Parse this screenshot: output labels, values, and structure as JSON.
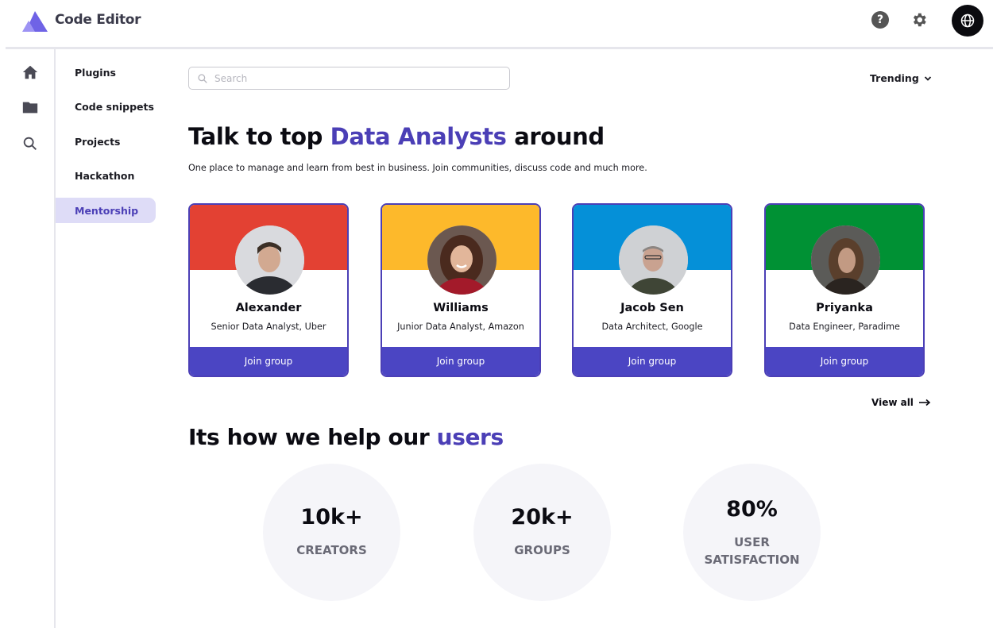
{
  "app": {
    "title": "Code Editor"
  },
  "header": {
    "help_glyph": "?"
  },
  "rail": {
    "icons": [
      "home-icon",
      "folder-icon",
      "search-icon"
    ]
  },
  "sidebar": {
    "items": [
      {
        "label": "Plugins"
      },
      {
        "label": "Code snippets"
      },
      {
        "label": "Projects"
      },
      {
        "label": "Hackathon"
      },
      {
        "label": "Mentorship",
        "active": true
      }
    ]
  },
  "search": {
    "placeholder": "Search",
    "value": ""
  },
  "sort": {
    "label": "Trending"
  },
  "hero": {
    "title_pre": "Talk to top ",
    "title_accent": "Data Analysts",
    "title_post": " around",
    "subtitle": "One place to manage and learn from best in business. Join communities, discuss code and much more."
  },
  "mentors": [
    {
      "name": "Alexander",
      "role": "Senior Data Analyst, Uber",
      "color": "#e34133",
      "button": "Join group"
    },
    {
      "name": "Williams",
      "role": "Junior Data Analyst, Amazon",
      "color": "#fdb92b",
      "button": "Join group"
    },
    {
      "name": "Jacob Sen",
      "role": "Data Architect, Google",
      "color": "#0590d8",
      "button": "Join group"
    },
    {
      "name": "Priyanka",
      "role": "Data Engineer, Paradime",
      "color": "#009134",
      "button": "Join group"
    }
  ],
  "view_all": "View all",
  "stats": {
    "title_pre": "Its how we help our ",
    "title_accent": "users",
    "items": [
      {
        "value": "10k+",
        "label_1": "CREATORS",
        "label_2": ""
      },
      {
        "value": "20k+",
        "label_1": "GROUPS",
        "label_2": ""
      },
      {
        "value": "80%",
        "label_1": "USER",
        "label_2": "SATISFACTION"
      }
    ]
  },
  "colors": {
    "accent": "#4b3fb6",
    "button": "#4b45c3",
    "active_bg": "#dedcf7"
  }
}
